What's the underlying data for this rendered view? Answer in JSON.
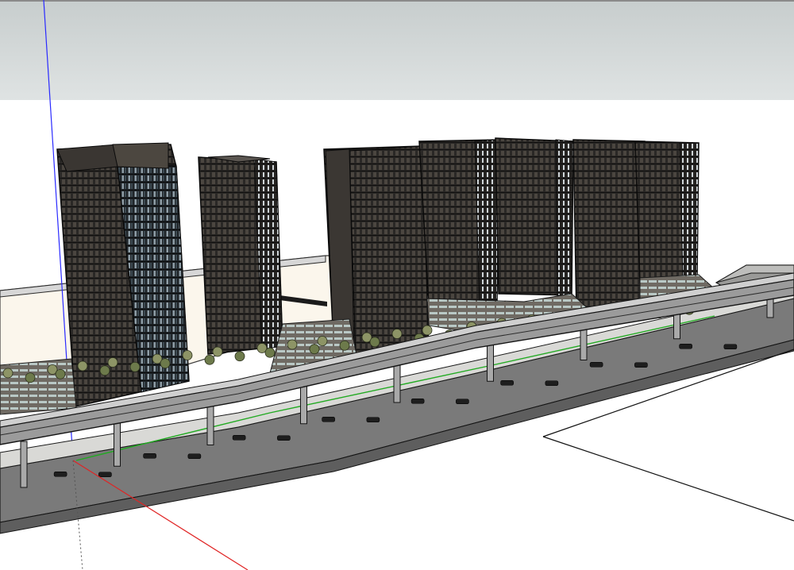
{
  "app": {
    "type": "3d-modeling-viewport"
  },
  "scene": {
    "sky_color": "#d9dede",
    "sky_top_color": "#c9cfcf",
    "ground_color": "#ffffff",
    "axis_colors": {
      "blue": "#2a2aff",
      "red": "#e02424",
      "green": "#22aa22"
    },
    "building_count": 6,
    "pier_count": 9,
    "tree_count": 40,
    "car_count": 16
  }
}
